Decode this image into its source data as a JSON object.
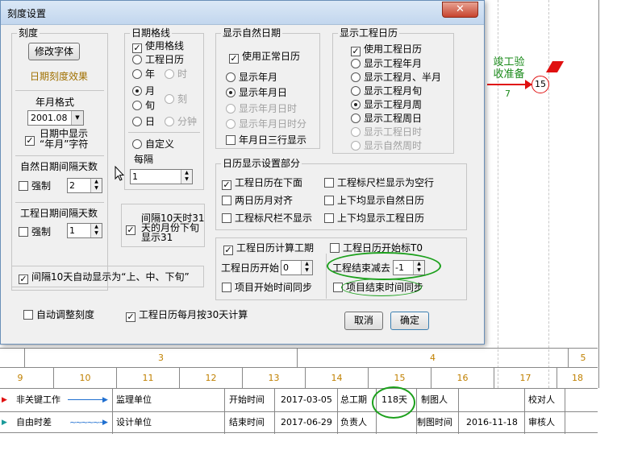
{
  "dialog": {
    "title": "刻度设置",
    "close_glyph": "✕",
    "scale": {
      "group": "刻度",
      "font_button": "修改字体",
      "effect_label": "日期刻度效果",
      "ym_format_label": "年月格式",
      "ym_format_value": "2001.08",
      "show_ym_line1": "日期中显示",
      "show_ym_line2": "“年月”字符"
    },
    "natural_interval": {
      "title": "自然日期间隔天数",
      "force": "强制",
      "value": "2"
    },
    "work_interval": {
      "title": "工程日期间隔天数",
      "force": "强制",
      "value": "1"
    },
    "auto_shangzhongxia": "间隔10天自动显示为“上、中、下旬”",
    "grid": {
      "group": "日期格线",
      "use": "使用格线",
      "work_cal": "工程日历",
      "year": "年",
      "hour": "时",
      "month": "月",
      "ke": "刻",
      "xun": "旬",
      "day": "日",
      "minute": "分钟",
      "custom": "自定义",
      "interval_label": "每隔",
      "interval_value": "1"
    },
    "interval31": {
      "line1": "间隔10天时31",
      "line2": "天的月份下旬",
      "line3": "显示31"
    },
    "natural_date": {
      "group": "显示自然日期",
      "use": "使用正常日历",
      "opts": [
        "显示年月",
        "显示年月日",
        "显示年月日时",
        "显示年月日时分"
      ],
      "three_line": "年月日三行显示"
    },
    "work_date": {
      "group": "显示工程日历",
      "use": "使用工程日历",
      "opts": [
        "显示工程年月",
        "显示工程月、半月",
        "显示工程月旬",
        "显示工程月周",
        "显示工程周日",
        "显示工程日时",
        "显示自然周时"
      ]
    },
    "cal_display": {
      "group": "日历显示设置部分",
      "c1": "工程日历在下面",
      "c2": "工程标尺栏显示为空行",
      "c3": "两日历月对齐",
      "c4": "上下均显示自然日历",
      "c5": "工程标尺栏不显示",
      "c6": "上下均显示工程日历"
    },
    "calc": {
      "calc_label": "工程日历计算工期",
      "start_zero": "工程日历开始标T0",
      "start_label": "工程日历开始",
      "start_value": "0",
      "end_minus_label": "工程结束减去",
      "end_minus_value": "-1",
      "sync_start": "项目开始时间同步",
      "sync_end": "项目结束时间同步"
    },
    "auto_adjust": "自动调整刻度",
    "month30": "工程日历每月按30天计算",
    "cancel": "取消",
    "ok": "确定"
  },
  "gantt": {
    "node_number": "15",
    "task_label_1": "竣工验",
    "task_label_2": "收准备",
    "task_duration": "7"
  },
  "timescale": {
    "months": [
      "3",
      "4",
      "5"
    ],
    "days": [
      "9",
      "10",
      "11",
      "12",
      "13",
      "14",
      "15",
      "16",
      "17",
      "18"
    ]
  },
  "footer": {
    "legend_critical": "非关键工作",
    "legend_float": "自由时差",
    "supervisor": "监理单位",
    "designer": "设计单位",
    "start_time_label": "开始时间",
    "start_time": "2017-03-05",
    "end_time_label": "结束时间",
    "end_time": "2017-06-29",
    "total_label": "总工期",
    "total_value": "118天",
    "owner_label": "负责人",
    "drawer_label": "制图人",
    "draw_time_label": "制图时间",
    "draw_time": "2016-11-18",
    "checker_label": "校对人",
    "reviewer_label": "审核人"
  },
  "colors": {
    "critical_red": "#e01010",
    "green": "#1a8a1a",
    "scale_text": "#c08000",
    "arrow_blue": "#1f6fd0"
  }
}
